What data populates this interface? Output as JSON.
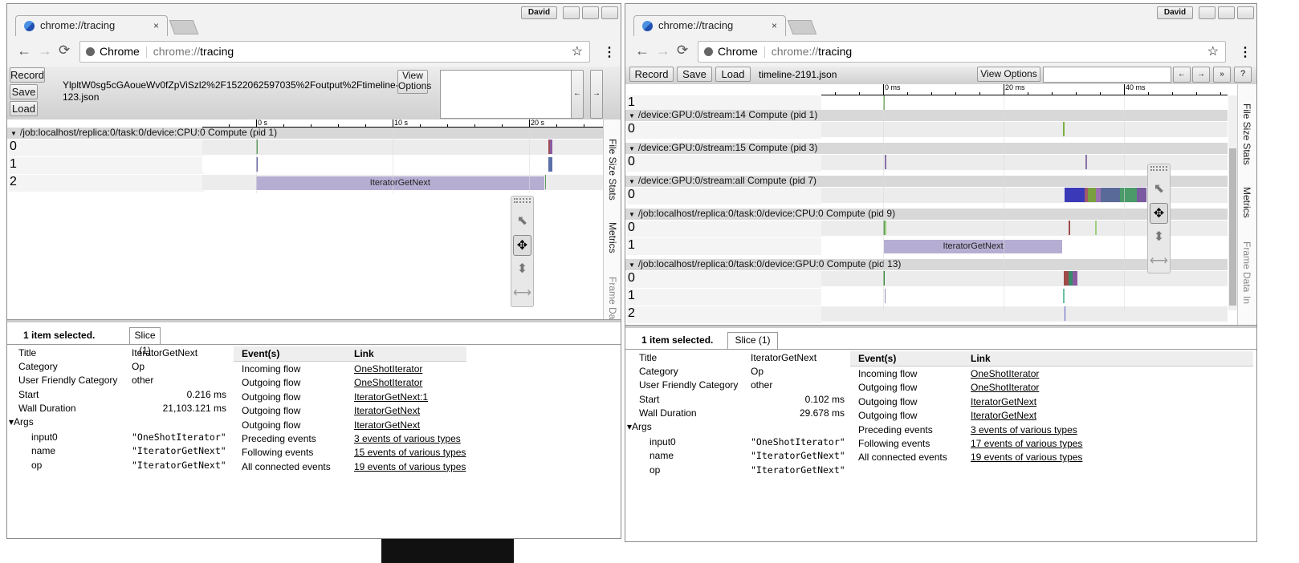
{
  "windows": [
    {
      "profile": "David",
      "tab_title": "chrome://tracing",
      "omnibox": {
        "site": "Chrome",
        "url_prefix": "chrome://",
        "url_path": "tracing"
      },
      "toolbar": {
        "record": "Record",
        "save": "Save",
        "load": "Load",
        "filename": "YlpltW0sg5cGAoueWv0fZpViSzl2%2F1522062597035%2Foutput%2Ftimeline-123.json",
        "view_options": "View Options",
        "prev": "←",
        "next": "→"
      },
      "ruler": {
        "unit": "s",
        "ticks": [
          "0 s",
          "10 s",
          "20 s"
        ],
        "tick_values": [
          0,
          10,
          20
        ]
      },
      "tracks": [
        {
          "title": "/job:localhost/replica:0/task:0/device:CPU:0 Compute (pid 1)",
          "rows": [
            {
              "label": "0",
              "slices": [
                {
                  "start": 0,
                  "dur": 0.06,
                  "color": "#5a9a5a"
                },
                {
                  "start": 21.4,
                  "dur": 0.15,
                  "color": "#a04a5a"
                },
                {
                  "start": 21.55,
                  "dur": 0.15,
                  "color": "#8a5aa0"
                }
              ]
            },
            {
              "label": "1",
              "slices": [
                {
                  "start": 0,
                  "dur": 0.06,
                  "color": "#6a6aa8"
                },
                {
                  "start": 21.4,
                  "dur": 0.3,
                  "color": "#5a70a8"
                }
              ]
            },
            {
              "label": "2",
              "slices": [
                {
                  "start": 0.000216,
                  "dur": 21.103121,
                  "color": "#b6aed2",
                  "name": "IteratorGetNext"
                },
                {
                  "start": 21.15,
                  "dur": 0.06,
                  "color": "#5a9a5a"
                }
              ]
            }
          ]
        }
      ],
      "side_tabs": [
        "File Size Stats",
        "Metrics",
        "Frame Dat"
      ],
      "details": {
        "selected": "1 item selected.",
        "tab": "Slice (1)",
        "props": [
          [
            "Title",
            "IteratorGetNext"
          ],
          [
            "Category",
            "Op"
          ],
          [
            "User Friendly Category",
            "other"
          ],
          [
            "Start",
            "0.216 ms"
          ],
          [
            "Wall Duration",
            "21,103.121 ms"
          ]
        ],
        "args_label": "▾Args",
        "args": [
          [
            "input0",
            "\"OneShotIterator\""
          ],
          [
            "name",
            "\"IteratorGetNext\""
          ],
          [
            "op",
            "\"IteratorGetNext\""
          ]
        ],
        "events_header": "Event(s)",
        "link_header": "Link",
        "events": [
          [
            "Incoming flow",
            "OneShotIterator"
          ],
          [
            "Outgoing flow",
            "OneShotIterator"
          ],
          [
            "Outgoing flow",
            "IteratorGetNext:1"
          ],
          [
            "Outgoing flow",
            "IteratorGetNext"
          ],
          [
            "Outgoing flow",
            "IteratorGetNext"
          ],
          [
            "Preceding events",
            "3 events of various types"
          ],
          [
            "Following events",
            "15 events of various types"
          ],
          [
            "All connected events",
            "19 events of various types"
          ]
        ]
      }
    },
    {
      "profile": "David",
      "tab_title": "chrome://tracing",
      "omnibox": {
        "site": "Chrome",
        "url_prefix": "chrome://",
        "url_path": "tracing"
      },
      "toolbar": {
        "record": "Record",
        "save": "Save",
        "load": "Load",
        "filename": "timeline-2191.json",
        "view_options": "View Options",
        "prev": "←",
        "next": "→",
        "more": "»",
        "help": "?"
      },
      "ruler": {
        "unit": "ms",
        "ticks": [
          "0 ms",
          "20 ms",
          "40 ms"
        ],
        "tick_values": [
          0,
          20,
          40
        ]
      },
      "partial_row": {
        "label": "1",
        "slices": [
          {
            "start": 0,
            "dur": 0.15,
            "color": "#7ab06a"
          }
        ]
      },
      "tracks": [
        {
          "title": "/device:GPU:0/stream:14 Compute (pid 1)",
          "rows": [
            {
              "label": "0",
              "slices": [
                {
                  "start": 29.9,
                  "dur": 0.2,
                  "color": "#7ab040"
                }
              ]
            }
          ]
        },
        {
          "title": "/device:GPU:0/stream:15 Compute (pid 3)",
          "rows": [
            {
              "label": "0",
              "slices": [
                {
                  "start": 0.3,
                  "dur": 0.15,
                  "color": "#8a70a8"
                },
                {
                  "start": 33.6,
                  "dur": 0.15,
                  "color": "#8a70a8"
                }
              ]
            }
          ]
        },
        {
          "title": "/device:GPU:0/stream:all Compute (pid 7)",
          "rows": [
            {
              "label": "0",
              "slices": [
                {
                  "start": 30.1,
                  "dur": 3.3,
                  "color": "#3a3ab8"
                },
                {
                  "start": 33.4,
                  "dur": 0.6,
                  "color": "#a05a6a"
                },
                {
                  "start": 34.0,
                  "dur": 1.3,
                  "color": "#7aa040"
                },
                {
                  "start": 35.3,
                  "dur": 0.8,
                  "color": "#9a70b0"
                },
                {
                  "start": 36.1,
                  "dur": 3.2,
                  "color": "#5a6a98"
                },
                {
                  "start": 39.3,
                  "dur": 2.8,
                  "color": "#4a9a6a"
                },
                {
                  "start": 42.1,
                  "dur": 1.6,
                  "color": "#7a5aa0"
                }
              ]
            }
          ]
        },
        {
          "title": "/job:localhost/replica:0/task:0/device:CPU:0 Compute (pid 9)",
          "rows": [
            {
              "label": "0",
              "slices": [
                {
                  "start": 0,
                  "dur": 0.3,
                  "color": "#5a9a5a"
                },
                {
                  "start": 0.3,
                  "dur": 0.15,
                  "color": "#a0d080"
                },
                {
                  "start": 30.8,
                  "dur": 0.12,
                  "color": "#a04a4a"
                },
                {
                  "start": 35.2,
                  "dur": 0.15,
                  "color": "#a0d080"
                }
              ]
            },
            {
              "label": "1",
              "slices": [
                {
                  "start": 0.102,
                  "dur": 29.678,
                  "color": "#b6aed2",
                  "name": "IteratorGetNext"
                }
              ]
            }
          ]
        },
        {
          "title": "/job:localhost/replica:0/task:0/device:GPU:0 Compute (pid 13)",
          "rows": [
            {
              "label": "0",
              "slices": [
                {
                  "start": 0,
                  "dur": 0.3,
                  "color": "#3a8a3a"
                },
                {
                  "start": 30.0,
                  "dur": 0.8,
                  "color": "#a04a4a"
                },
                {
                  "start": 30.8,
                  "dur": 0.7,
                  "color": "#3a8a6a"
                },
                {
                  "start": 31.5,
                  "dur": 0.8,
                  "color": "#8a5aa0"
                }
              ]
            },
            {
              "label": "1",
              "slices": [
                {
                  "start": 0.2,
                  "dur": 0.15,
                  "color": "#9a8ac0"
                },
                {
                  "start": 29.9,
                  "dur": 0.15,
                  "color": "#6ac0a0"
                }
              ]
            },
            {
              "label": "2",
              "slices": [
                {
                  "start": 30.1,
                  "dur": 0.2,
                  "color": "#5a5ac0"
                }
              ]
            }
          ]
        }
      ],
      "side_tabs": [
        "File Size Stats",
        "Metrics",
        "Frame Data",
        "In"
      ],
      "details": {
        "selected": "1 item selected.",
        "tab": "Slice (1)",
        "props": [
          [
            "Title",
            "IteratorGetNext"
          ],
          [
            "Category",
            "Op"
          ],
          [
            "User Friendly Category",
            "other"
          ],
          [
            "Start",
            "0.102 ms"
          ],
          [
            "Wall Duration",
            "29.678 ms"
          ]
        ],
        "args_label": "▾Args",
        "args": [
          [
            "input0",
            "\"OneShotIterator\""
          ],
          [
            "name",
            "\"IteratorGetNext\""
          ],
          [
            "op",
            "\"IteratorGetNext\""
          ]
        ],
        "events_header": "Event(s)",
        "link_header": "Link",
        "events": [
          [
            "Incoming flow",
            "OneShotIterator"
          ],
          [
            "Outgoing flow",
            "OneShotIterator"
          ],
          [
            "Outgoing flow",
            "IteratorGetNext"
          ],
          [
            "Outgoing flow",
            "IteratorGetNext"
          ],
          [
            "Preceding events",
            "3 events of various types"
          ],
          [
            "Following events",
            "17 events of various types"
          ],
          [
            "All connected events",
            "19 events of various types"
          ]
        ]
      }
    }
  ]
}
